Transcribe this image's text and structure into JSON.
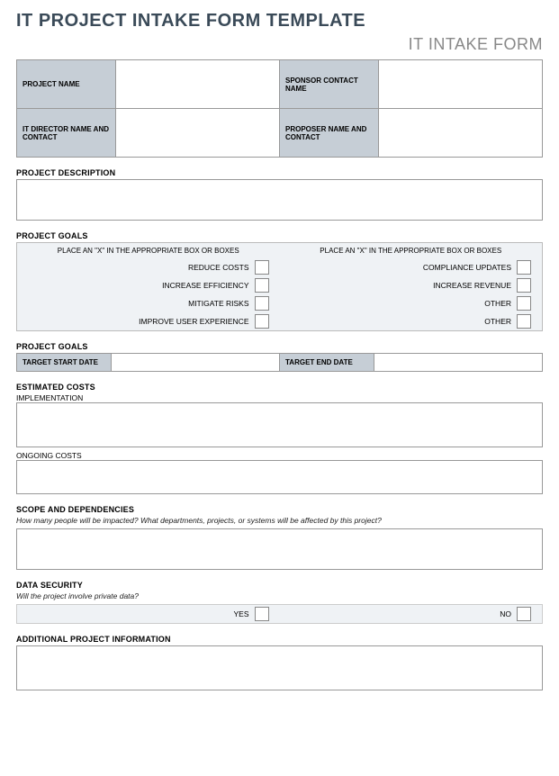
{
  "title": "IT PROJECT INTAKE FORM TEMPLATE",
  "subtitle": "IT INTAKE FORM",
  "header": {
    "project_name_label": "PROJECT NAME",
    "project_name_value": "",
    "sponsor_label": "SPONSOR CONTACT NAME",
    "sponsor_value": "",
    "it_director_label": "IT DIRECTOR NAME AND CONTACT",
    "it_director_value": "",
    "proposer_label": "PROPOSER NAME AND CONTACT",
    "proposer_value": ""
  },
  "description": {
    "title": "PROJECT DESCRIPTION",
    "value": ""
  },
  "goals": {
    "title": "PROJECT GOALS",
    "hint": "PLACE AN \"X\" IN THE APPROPRIATE BOX OR BOXES",
    "left": [
      {
        "label": "REDUCE COSTS",
        "value": ""
      },
      {
        "label": "INCREASE EFFICIENCY",
        "value": ""
      },
      {
        "label": "MITIGATE RISKS",
        "value": ""
      },
      {
        "label": "IMPROVE USER EXPERIENCE",
        "value": ""
      }
    ],
    "right": [
      {
        "label": "COMPLIANCE UPDATES",
        "value": ""
      },
      {
        "label": "INCREASE REVENUE",
        "value": ""
      },
      {
        "label": "OTHER",
        "value": ""
      },
      {
        "label": "OTHER",
        "value": ""
      }
    ]
  },
  "dates": {
    "title": "PROJECT GOALS",
    "start_label": "TARGET START DATE",
    "start_value": "",
    "end_label": "TARGET END DATE",
    "end_value": ""
  },
  "costs": {
    "title": "ESTIMATED COSTS",
    "impl_label": "IMPLEMENTATION",
    "impl_value": "",
    "ongoing_label": "ONGOING COSTS",
    "ongoing_value": ""
  },
  "scope": {
    "title": "SCOPE AND DEPENDENCIES",
    "hint": "How many people will be impacted? What departments, projects, or systems will be affected by this project?",
    "value": ""
  },
  "security": {
    "title": "DATA SECURITY",
    "hint": "Will the project involve private data?",
    "yes_label": "YES",
    "yes_value": "",
    "no_label": "NO",
    "no_value": ""
  },
  "additional": {
    "title": "ADDITIONAL PROJECT INFORMATION",
    "value": ""
  }
}
